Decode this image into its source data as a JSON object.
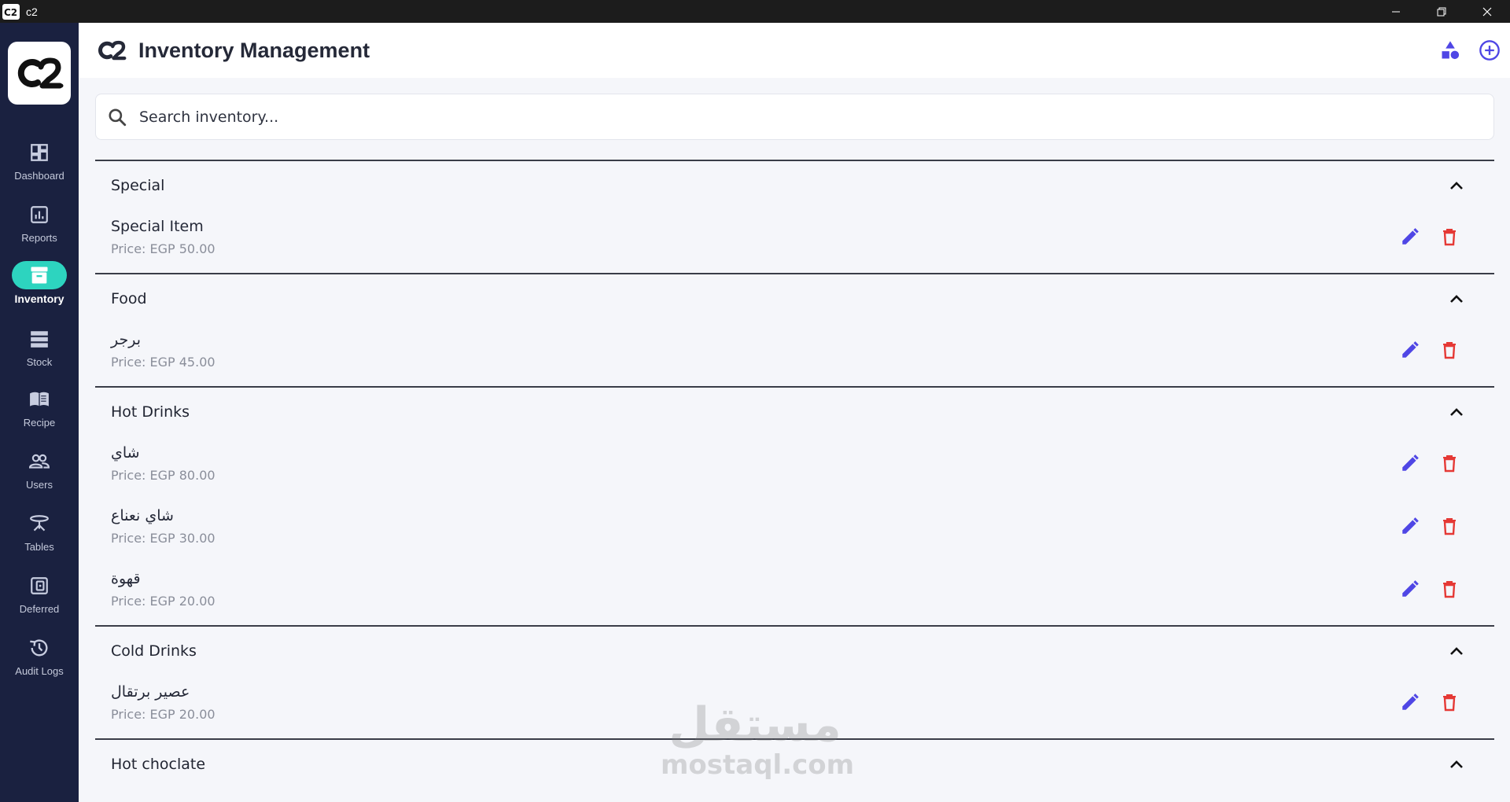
{
  "window": {
    "title": "c2"
  },
  "sidebar": {
    "items": [
      {
        "label": "Dashboard",
        "icon": "dashboard-icon"
      },
      {
        "label": "Reports",
        "icon": "reports-icon"
      },
      {
        "label": "Inventory",
        "icon": "inventory-icon",
        "active": true
      },
      {
        "label": "Stock",
        "icon": "stock-icon"
      },
      {
        "label": "Recipe",
        "icon": "recipe-icon"
      },
      {
        "label": "Users",
        "icon": "users-icon"
      },
      {
        "label": "Tables",
        "icon": "tables-icon"
      },
      {
        "label": "Deferred",
        "icon": "deferred-icon"
      },
      {
        "label": "Audit Logs",
        "icon": "audit-logs-icon"
      }
    ]
  },
  "header": {
    "title": "Inventory Management"
  },
  "search": {
    "placeholder": "Search inventory..."
  },
  "categories": [
    {
      "name": "Special",
      "items": [
        {
          "name": "Special Item",
          "price": "Price: EGP 50.00"
        }
      ]
    },
    {
      "name": "Food",
      "items": [
        {
          "name": "برجر",
          "price": "Price: EGP 45.00"
        }
      ]
    },
    {
      "name": "Hot Drinks",
      "items": [
        {
          "name": "شاي",
          "price": "Price: EGP 80.00"
        },
        {
          "name": "شاي نعناع",
          "price": "Price: EGP 30.00"
        },
        {
          "name": "قهوة",
          "price": "Price: EGP 20.00"
        }
      ]
    },
    {
      "name": "Cold Drinks",
      "items": [
        {
          "name": "عصير برتقال",
          "price": "Price: EGP 20.00"
        }
      ]
    },
    {
      "name": "Hot choclate",
      "items": []
    }
  ],
  "watermark": {
    "arabic": "مستقل",
    "latin": "mostaql.com"
  },
  "colors": {
    "sidebar_bg": "#1a2140",
    "active_nav": "#2dd4bf",
    "accent": "#4f46e5",
    "delete": "#e53935",
    "titlebar": "#1c1c1c"
  }
}
